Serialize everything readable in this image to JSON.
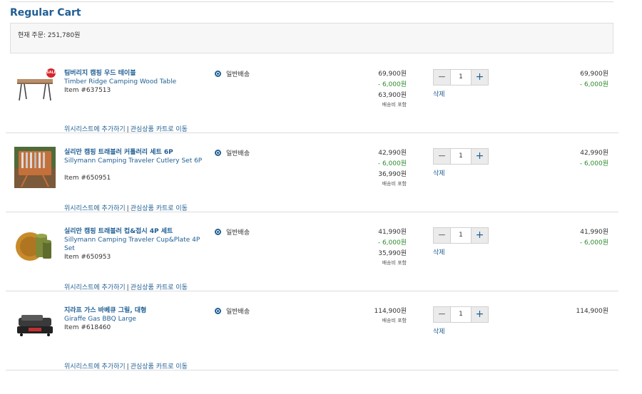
{
  "cart": {
    "title": "Regular Cart",
    "current_order": "현재 주문: 251,780원"
  },
  "items": [
    {
      "name_ko": "팀버리지 캠핑 우드 테이블",
      "name_en": "Timber Ridge Camping Wood Table",
      "item_no": "Item #637513",
      "shipping": "일반배송",
      "price": "69,900원",
      "discount": "- 6,000원",
      "final": "63,900원",
      "ship_note": "배송비 포함",
      "qty": "1",
      "delete": "삭제",
      "total": "69,900원",
      "total_discount": "- 6,000원",
      "badge": "SALE",
      "wishlist": "위시리스트에 추가하기",
      "sep": "|",
      "saved": "관심상품 카트로 이동",
      "image": "table"
    },
    {
      "name_ko": "실리만 캠핑 트래블러 커틀러리 세트 6P",
      "name_en": "Sillymann Camping Traveler Cutlery Set 6P",
      "item_no": "Item #650951",
      "shipping": "일반배송",
      "price": "42,990원",
      "discount": "- 6,000원",
      "final": "36,990원",
      "ship_note": "배송비 포함",
      "qty": "1",
      "delete": "삭제",
      "total": "42,990원",
      "total_discount": "- 6,000원",
      "badge": "",
      "wishlist": "위시리스트에 추가하기",
      "sep": "|",
      "saved": "관심상품 카트로 이동",
      "image": "cutlery"
    },
    {
      "name_ko": "실리만 캠핑 트래블러 컵&접시 4P 세트",
      "name_en": "Sillymann Camping Traveler Cup&Plate 4P Set",
      "item_no": "Item #650953",
      "shipping": "일반배송",
      "price": "41,990원",
      "discount": "- 6,000원",
      "final": "35,990원",
      "ship_note": "배송비 포함",
      "qty": "1",
      "delete": "삭제",
      "total": "41,990원",
      "total_discount": "- 6,000원",
      "badge": "",
      "wishlist": "위시리스트에 추가하기",
      "sep": "|",
      "saved": "관심상품 카트로 이동",
      "image": "cups"
    },
    {
      "name_ko": "지라프 가스 바베큐 그릴, 대형",
      "name_en": "Giraffe Gas BBQ Large",
      "item_no": "Item #618460",
      "shipping": "일반배송",
      "price": "114,900원",
      "discount": "",
      "final": "",
      "ship_note": "배송비 포함",
      "qty": "1",
      "delete": "삭제",
      "total": "114,900원",
      "total_discount": "",
      "badge": "",
      "wishlist": "위시리스트에 추가하기",
      "sep": "|",
      "saved": "관심상품 카트로 이동",
      "image": "grill"
    }
  ],
  "colors": {
    "brand_blue": "#1f5e94",
    "discount_green": "#2e8b2e",
    "badge_red": "#d7252c"
  }
}
